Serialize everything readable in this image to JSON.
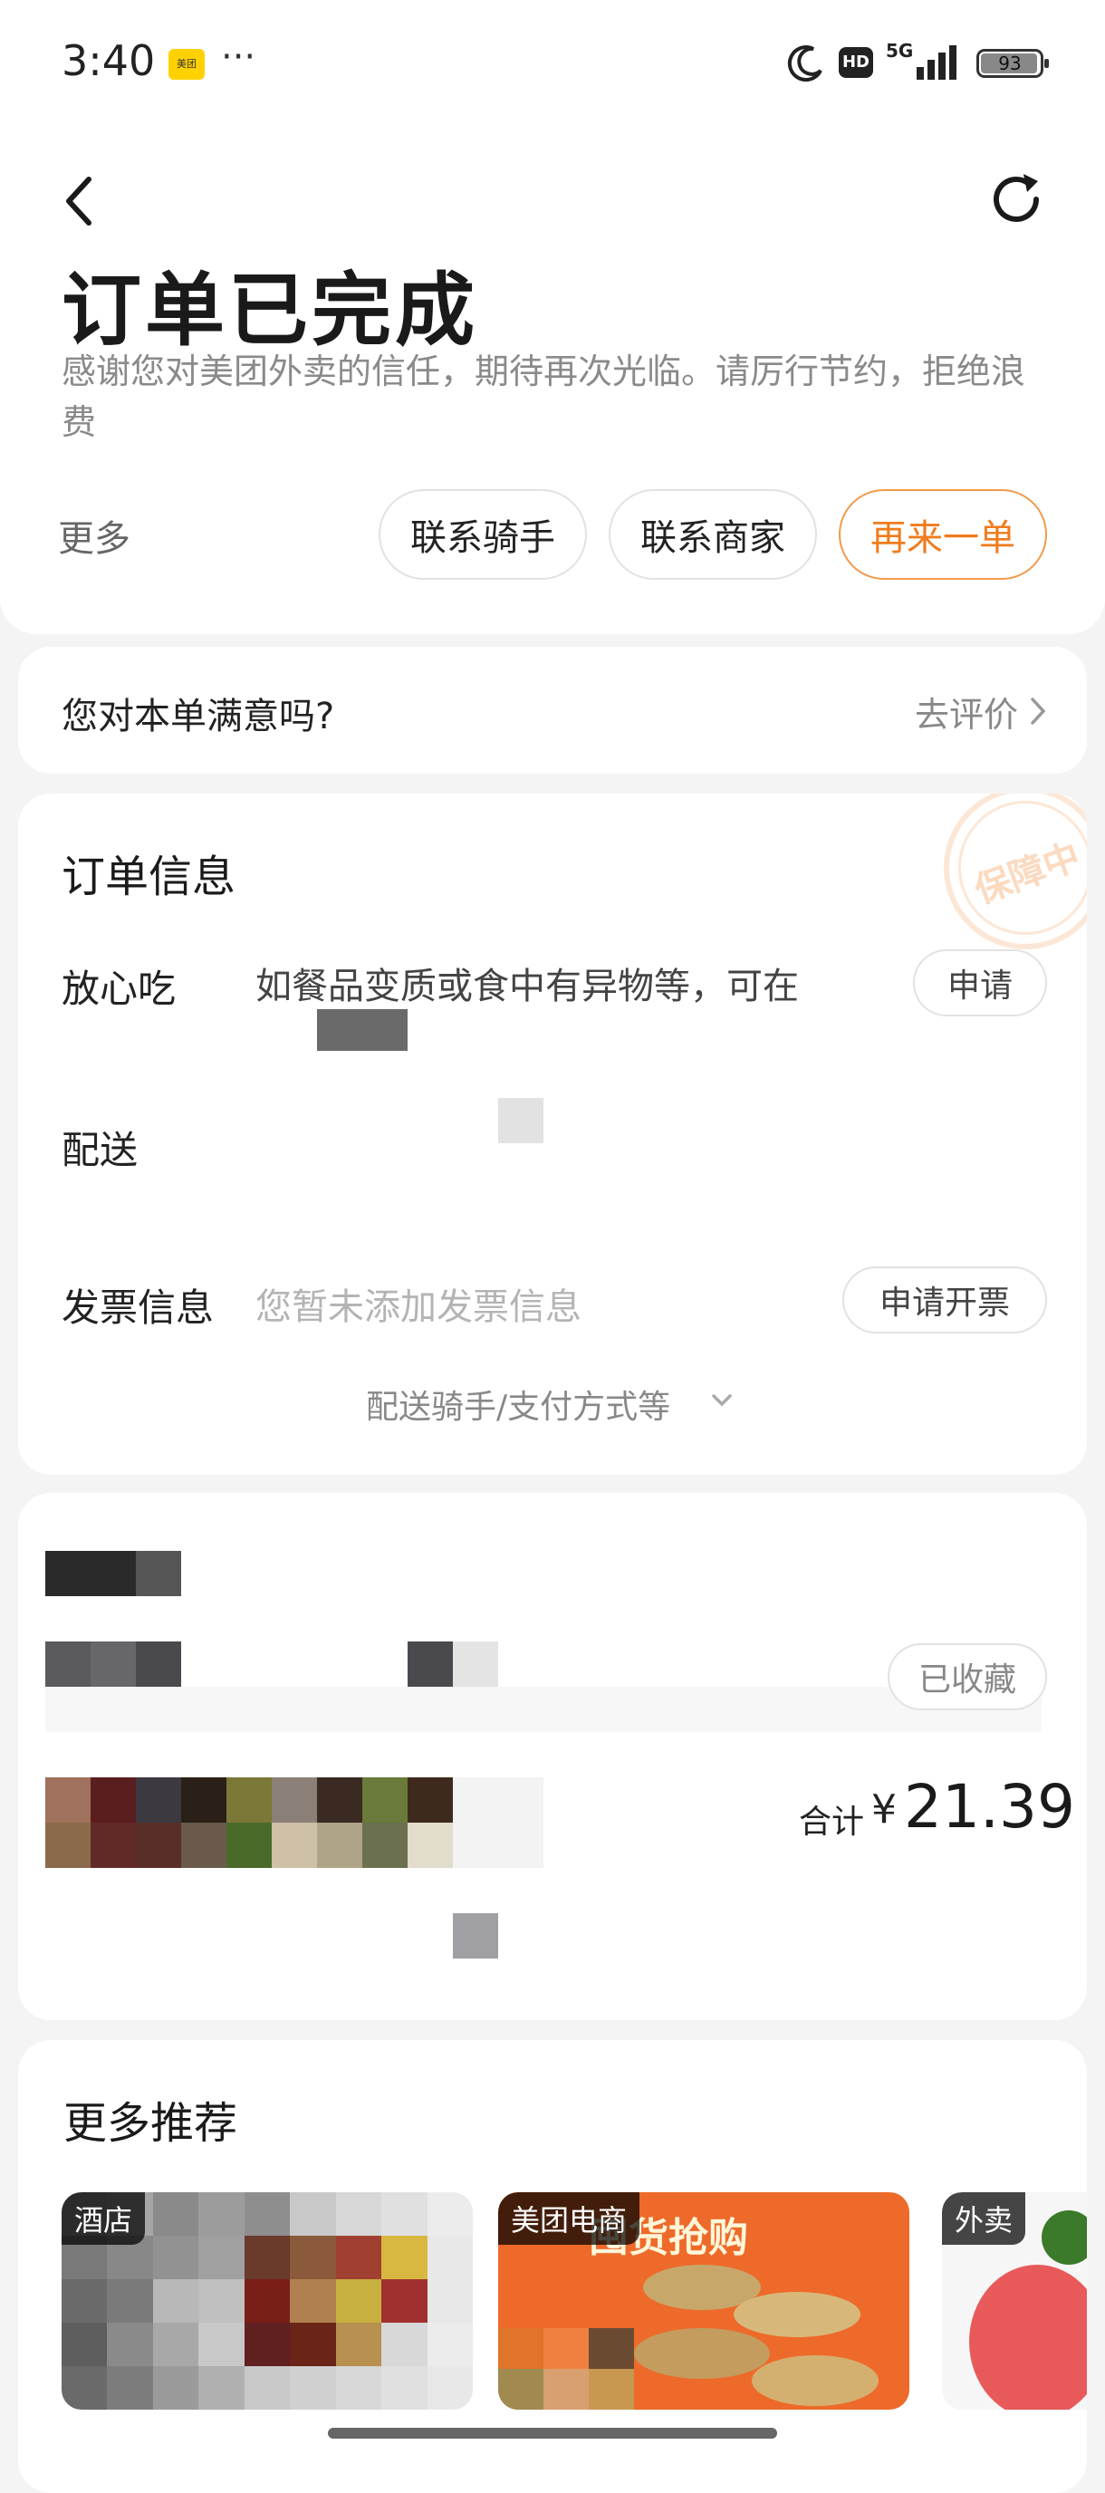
{
  "status_bar": {
    "time": "3:40",
    "app_icon_label": "美团",
    "dots": "···",
    "network": "5G",
    "battery": "93"
  },
  "header": {
    "title": "订单已完成",
    "subtitle": "感谢您对美团外卖的信任，期待再次光临。请厉行节约，拒绝浪费",
    "more_label": "更多",
    "buttons": {
      "contact_rider": "联系骑手",
      "contact_merchant": "联系商家",
      "reorder": "再来一单"
    }
  },
  "rating": {
    "question": "您对本单满意吗?",
    "link": "去评价"
  },
  "order_info": {
    "title": "订单信息",
    "stamp": "保障中",
    "rows": {
      "safe_eat_label": "放心吃",
      "safe_eat_text": "如餐品变质或食中有异物等，可在",
      "safe_eat_button": "申请",
      "delivery_label": "配送",
      "invoice_label": "发票信息",
      "invoice_text": "您暂未添加发票信息",
      "invoice_button": "申请开票"
    },
    "expand_label": "配送骑手/支付方式等"
  },
  "store": {
    "favorited": "已收藏",
    "total_label": "合计",
    "currency": "¥",
    "total_value": "21.39"
  },
  "recommend": {
    "title": "更多推荐",
    "cards": [
      {
        "tag": "酒店"
      },
      {
        "tag": "美团电商",
        "banner": "囤货抢购"
      },
      {
        "tag": "外卖"
      }
    ]
  },
  "colors": {
    "accent_orange": "#f07b1c",
    "background": "#f4f4f4"
  }
}
